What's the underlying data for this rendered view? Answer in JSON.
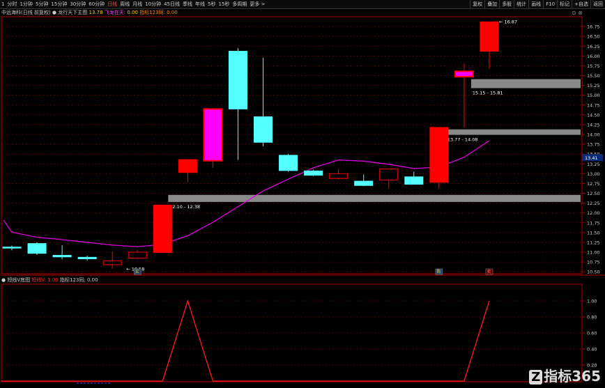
{
  "toolbar": {
    "periods": [
      "1",
      "分时",
      "1分钟",
      "5分钟",
      "15分钟",
      "30分钟",
      "60分钟",
      "日线",
      "周线",
      "月线",
      "10分钟",
      "45日线",
      "季线",
      "年线",
      "5秒",
      "15秒",
      "多周期",
      "更多 >"
    ],
    "active_period_index": 7,
    "right": [
      "复权",
      "叠加",
      "多股",
      "统计",
      "画线",
      "F10",
      "标记",
      "+自选",
      "返回"
    ]
  },
  "main_info": {
    "name": "中远海科(日线 前复权)",
    "indicator_title": "龙行天下主图",
    "v1": "13.78",
    "v2_label": "飞龙在天:",
    "v2": "0.00",
    "v3": "指标123同: 0.00"
  },
  "sub_info": {
    "name": "短线V底图",
    "v1": "短线V: 1.00",
    "v2": "指标123同: 0.00"
  },
  "colors": {
    "up": "#ff0000",
    "down": "#54ffff",
    "ma": "#e100e1",
    "zone": "#8a8a8a",
    "magenta": "#ff00ff",
    "grid": "#660000",
    "axis": "#b40000"
  },
  "chart_data": {
    "type": "candlestick",
    "ylim": [
      10.45,
      17.0
    ],
    "y_ticks": [
      "16.75",
      "16.50",
      "16.25",
      "16.00",
      "15.75",
      "15.50",
      "15.25",
      "15.00",
      "14.75",
      "14.50",
      "14.25",
      "14.00",
      "13.75",
      "13.50",
      "13.25",
      "13.00",
      "12.75",
      "12.50",
      "12.25",
      "12.00",
      "11.75",
      "11.50",
      "11.25",
      "11.00",
      "10.75",
      "10.50"
    ],
    "current_price": "13.41",
    "candles": [
      {
        "o": 11.13,
        "h": 11.17,
        "l": 11.05,
        "c": 11.11,
        "col": "down"
      },
      {
        "o": 11.22,
        "h": 11.25,
        "l": 10.93,
        "c": 10.97,
        "col": "down"
      },
      {
        "o": 10.92,
        "h": 11.18,
        "l": 10.82,
        "c": 10.88,
        "col": "down"
      },
      {
        "o": 10.87,
        "h": 10.91,
        "l": 10.79,
        "c": 10.83,
        "col": "down"
      },
      {
        "o": 10.68,
        "h": 11.01,
        "l": 10.58,
        "c": 10.78,
        "col": "doji"
      },
      {
        "o": 10.85,
        "h": 11.06,
        "l": 10.82,
        "c": 11.0,
        "col": "doji"
      },
      {
        "o": 10.99,
        "h": 12.2,
        "l": 10.99,
        "c": 12.2,
        "col": "up"
      },
      {
        "o": 13.03,
        "h": 13.36,
        "l": 12.78,
        "c": 13.36,
        "col": "up"
      },
      {
        "o": 13.33,
        "h": 14.65,
        "l": 13.15,
        "c": 14.65,
        "col": "magenta"
      },
      {
        "o": 16.12,
        "h": 16.2,
        "l": 13.35,
        "c": 14.65,
        "col": "down"
      },
      {
        "o": 14.45,
        "h": 15.95,
        "l": 13.7,
        "c": 13.8,
        "col": "down"
      },
      {
        "o": 13.47,
        "h": 13.5,
        "l": 13.05,
        "c": 13.08,
        "col": "down"
      },
      {
        "o": 13.07,
        "h": 13.1,
        "l": 12.94,
        "c": 12.96,
        "col": "down"
      },
      {
        "o": 13.0,
        "h": 13.12,
        "l": 12.85,
        "c": 12.88,
        "col": "doji"
      },
      {
        "o": 12.81,
        "h": 12.98,
        "l": 12.68,
        "c": 12.7,
        "col": "down"
      },
      {
        "o": 13.12,
        "h": 13.12,
        "l": 12.62,
        "c": 12.84,
        "col": "doji"
      },
      {
        "o": 12.92,
        "h": 13.05,
        "l": 12.72,
        "c": 12.73,
        "col": "down"
      },
      {
        "o": 12.78,
        "h": 14.18,
        "l": 12.62,
        "c": 14.18,
        "col": "up"
      },
      {
        "o": 15.47,
        "h": 15.81,
        "l": 14.18,
        "c": 15.61,
        "col": "magenta"
      },
      {
        "o": 16.12,
        "h": 16.87,
        "l": 15.67,
        "c": 16.87,
        "col": "up"
      }
    ],
    "ma": [
      11.51,
      11.38,
      11.32,
      11.25,
      11.18,
      11.14,
      11.2,
      11.42,
      11.76,
      12.16,
      12.56,
      12.86,
      13.15,
      13.35,
      13.32,
      13.24,
      13.13,
      13.17,
      13.42,
      13.84
    ],
    "zones": [
      {
        "lo": 12.28,
        "hi": 12.46,
        "from": 6,
        "label": "12.10 - 12.38",
        "start_mark": "10.58",
        "note": ""
      },
      {
        "lo": 13.99,
        "hi": 14.13,
        "from": 17,
        "label": "13.77 - 14.08",
        "note": ""
      },
      {
        "lo": 15.18,
        "hi": 15.41,
        "from": 18,
        "label": "15.15 - 15.81",
        "note": ""
      }
    ],
    "high_label": "16.87",
    "markers": [
      {
        "i": 5,
        "t": "买"
      },
      {
        "i": 17,
        "t": "购"
      },
      {
        "i": 19,
        "t": "卖"
      }
    ],
    "sub_values": [
      0,
      0,
      0,
      0,
      0,
      0,
      0,
      1,
      0,
      0,
      0,
      0,
      0,
      0,
      0,
      0,
      0,
      0,
      0,
      1
    ],
    "sub_ylim": [
      0,
      1.0
    ],
    "sub_ticks": [
      "1.00",
      "0.80",
      "0.60",
      "0.40",
      "0.20"
    ]
  },
  "logo": {
    "mark": "Z",
    "text": "指标365"
  }
}
